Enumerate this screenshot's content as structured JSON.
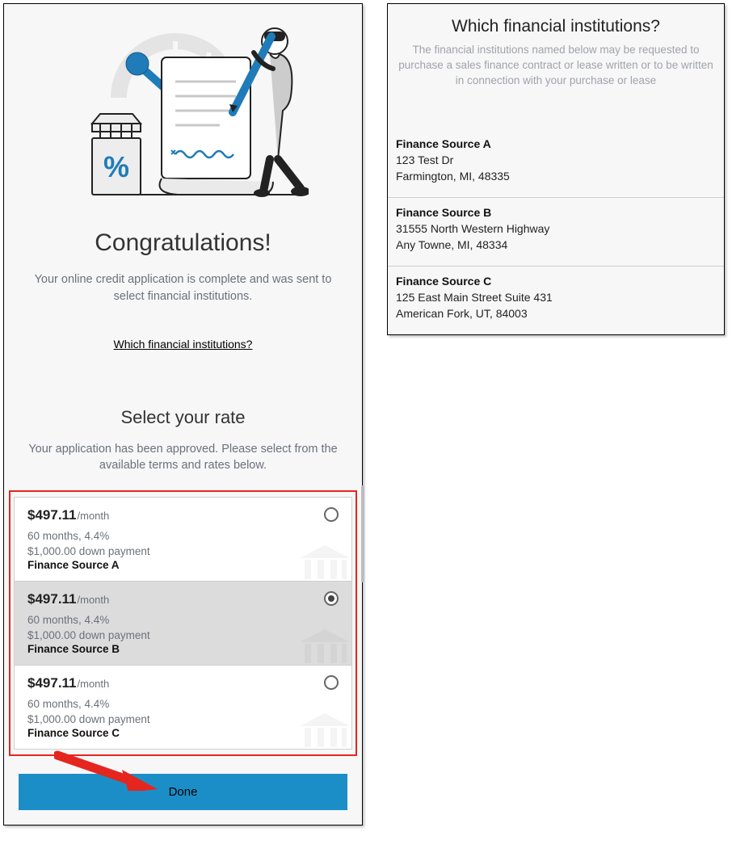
{
  "left": {
    "title": "Congratulations!",
    "subtitle": "Your online credit application is complete and was sent to select financial institutions.",
    "which_link": "Which financial institutions?",
    "select_title": "Select your rate",
    "select_sub": "Your application has been approved. Please select from the available terms and rates below.",
    "done_label": "Done"
  },
  "offers": [
    {
      "amount": "$497.11",
      "per": "/month",
      "terms": "60 months, 4.4%",
      "down": "$1,000.00 down payment",
      "source": "Finance Source A",
      "selected": false
    },
    {
      "amount": "$497.11",
      "per": "/month",
      "terms": "60 months, 4.4%",
      "down": "$1,000.00 down payment",
      "source": "Finance Source B",
      "selected": true
    },
    {
      "amount": "$497.11",
      "per": "/month",
      "terms": "60 months, 4.4%",
      "down": "$1,000.00 down payment",
      "source": "Finance Source C",
      "selected": false
    }
  ],
  "right": {
    "title": "Which financial institutions?",
    "subtitle": "The financial institutions named below may be requested to purchase a sales finance contract or lease written or to be written in connection with your purchase or lease"
  },
  "institutions": [
    {
      "name": "Finance Source A",
      "line1": "123 Test Dr",
      "line2": "Farmington, MI, 48335"
    },
    {
      "name": "Finance Source B",
      "line1": "31555 North Western Highway",
      "line2": "Any Towne, MI, 48334"
    },
    {
      "name": "Finance Source C",
      "line1": "125 East Main Street Suite 431",
      "line2": "American Fork, UT, 84003"
    }
  ],
  "colors": {
    "accent": "#1c8ec7",
    "highlight": "#e4261f"
  }
}
